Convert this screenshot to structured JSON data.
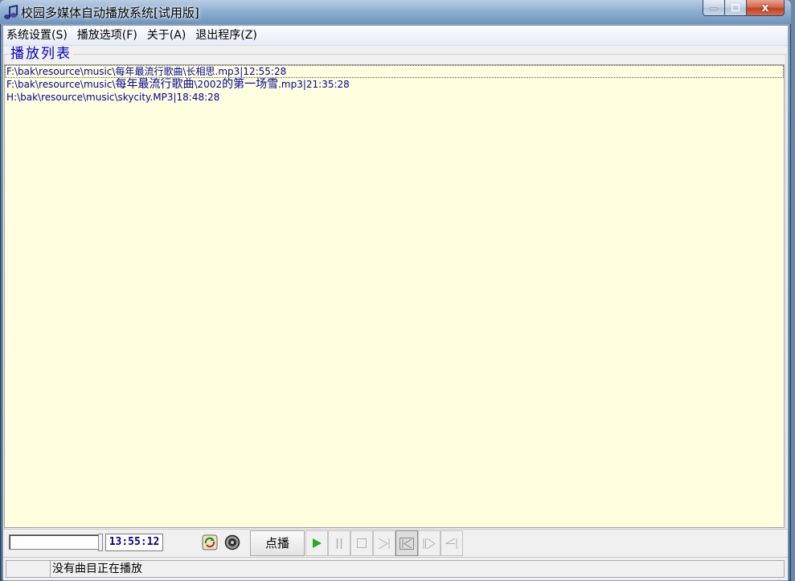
{
  "window": {
    "title": "校园多媒体自动播放系统[试用版]",
    "close_glyph": "x"
  },
  "menu": {
    "items": [
      "系统设置(S)",
      "播放选项(F)",
      "关于(A)",
      "退出程序(Z)"
    ]
  },
  "playlist": {
    "group_title": "播放列表",
    "rows": [
      {
        "prefix": "F:\\bak\\resource\\music\\",
        "cjk": "每年最流行歌曲\\长相思",
        "suffix": ".mp3|12:55:28"
      },
      {
        "prefix": "F:\\bak\\resource\\music\\",
        "cjk": "每年最流行歌曲",
        "mid": "\\2002",
        "cjk2": "的第一场雪",
        "suffix": ".mp3|21:35:28"
      },
      {
        "prefix": "H:\\bak\\resource\\music\\skycity.MP3|18:48:28",
        "cjk": "",
        "suffix": ""
      }
    ]
  },
  "toolbar": {
    "progress": 0,
    "time": "13:55:12",
    "request_button": "点播",
    "icons": [
      "refresh-icon",
      "speaker-icon"
    ],
    "controls": [
      "play-icon",
      "pause-icon",
      "stop-icon",
      "next-icon",
      "previous-icon",
      "forward-icon",
      "back-icon"
    ]
  },
  "status": {
    "message": "没有曲目正在播放"
  },
  "colors": {
    "playlist_bg": "#ffffe0",
    "playlist_text": "#0000a0",
    "group_title": "#0000c0",
    "play_green": "#22b022"
  }
}
